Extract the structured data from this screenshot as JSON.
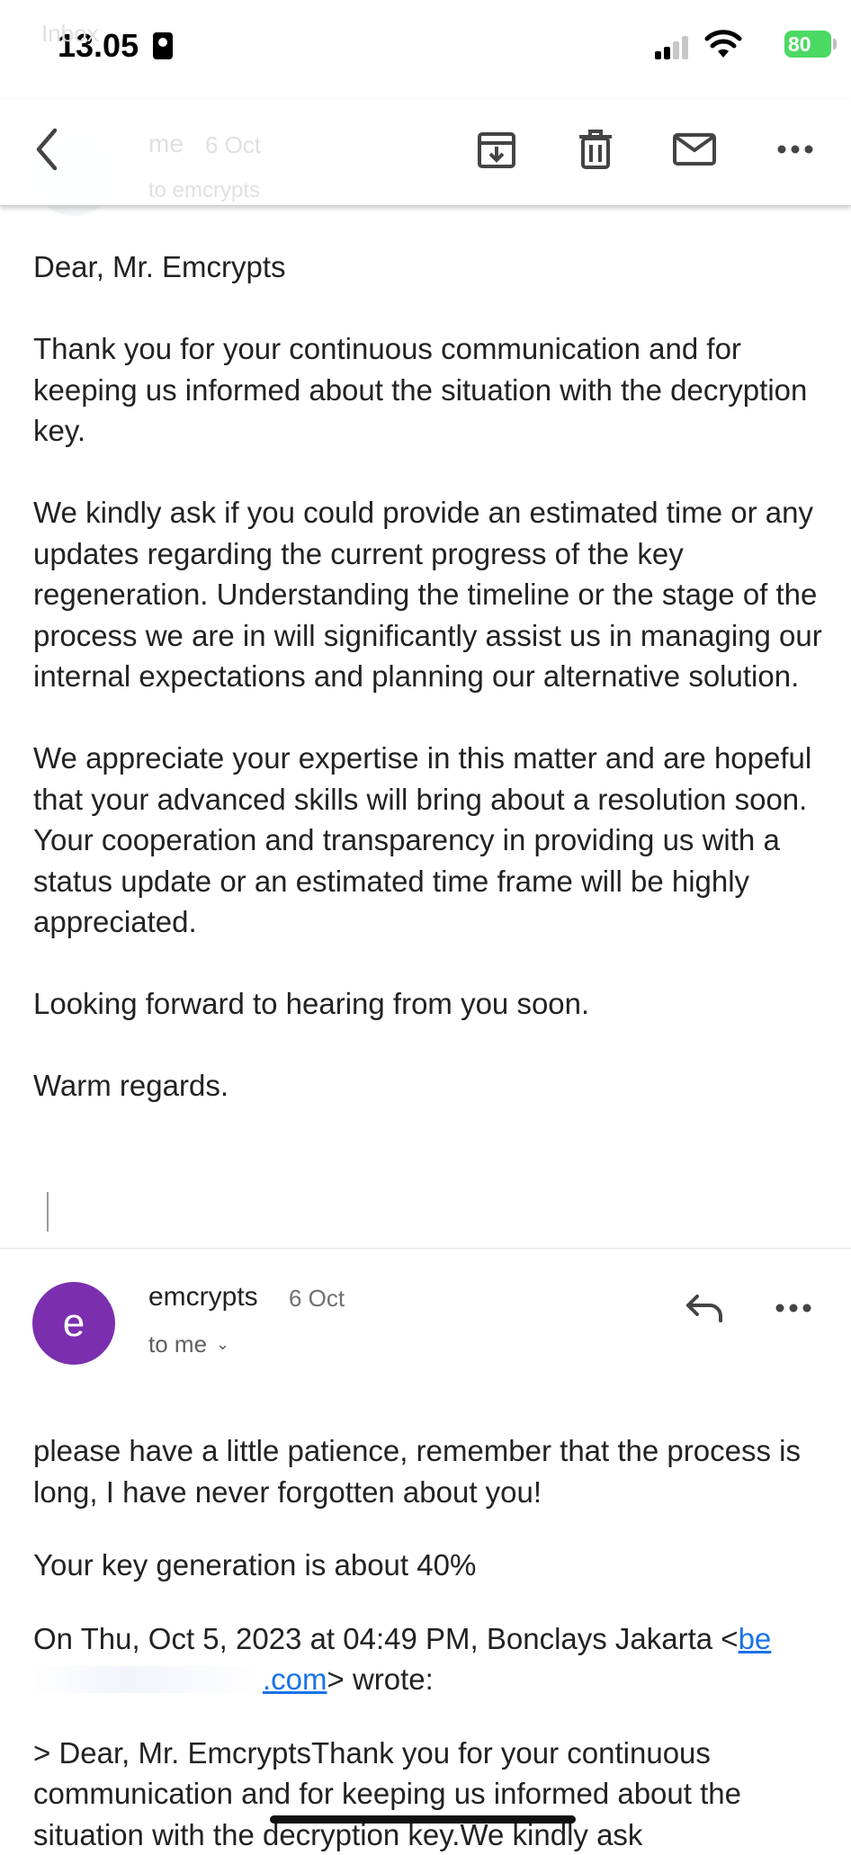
{
  "status_bar": {
    "time": "13.05",
    "battery": "80",
    "colors": {
      "battery": "#4cd964"
    }
  },
  "ghost": {
    "inbox": "Inbox",
    "sender": "me",
    "date": "6 Oct",
    "to": "to emcrypts"
  },
  "toolbar": {
    "icons": [
      "back-arrow-icon",
      "archive-icon",
      "delete-icon",
      "mark-unread-icon",
      "more-icon"
    ]
  },
  "message1": {
    "greeting": "Dear, Mr. Emcrypts",
    "paragraphs": [
      "Thank you for your continuous communication and for keeping us informed about the situation with the decryption key.",
      "We kindly ask if you could provide an estimated time or any updates regarding the current progress of the key regeneration. Understanding the timeline or the stage of the process we are in will significantly assist us in managing our internal expectations and planning our alternative solution.",
      "We appreciate your expertise in this matter and are hopeful that your advanced skills will bring about a resolution soon. Your cooperation and transparency in providing us with a status update or an estimated time frame will be highly appreciated.",
      "Looking forward to hearing from you soon."
    ],
    "closing": "Warm regards."
  },
  "message2": {
    "avatar_letter": "e",
    "avatar_color": "#7b2fae",
    "sender": "emcrypts",
    "date": "6 Oct",
    "to": "to me",
    "body": [
      "please have a little patience, remember that the process is long, I have never forgotten about you!",
      "Your key generation is about 40%"
    ],
    "quote_header_prefix": "On Thu, Oct 5, 2023 at 04:49 PM, Bonclays Jakarta <",
    "quote_link_start": "be",
    "quote_link_end": ".com",
    "quote_header_suffix": "> wrote:",
    "quoted": "> Dear, Mr. EmcryptsThank you for your continuous communication and for keeping us informed about the situation with the decryption key.We kindly ask"
  }
}
